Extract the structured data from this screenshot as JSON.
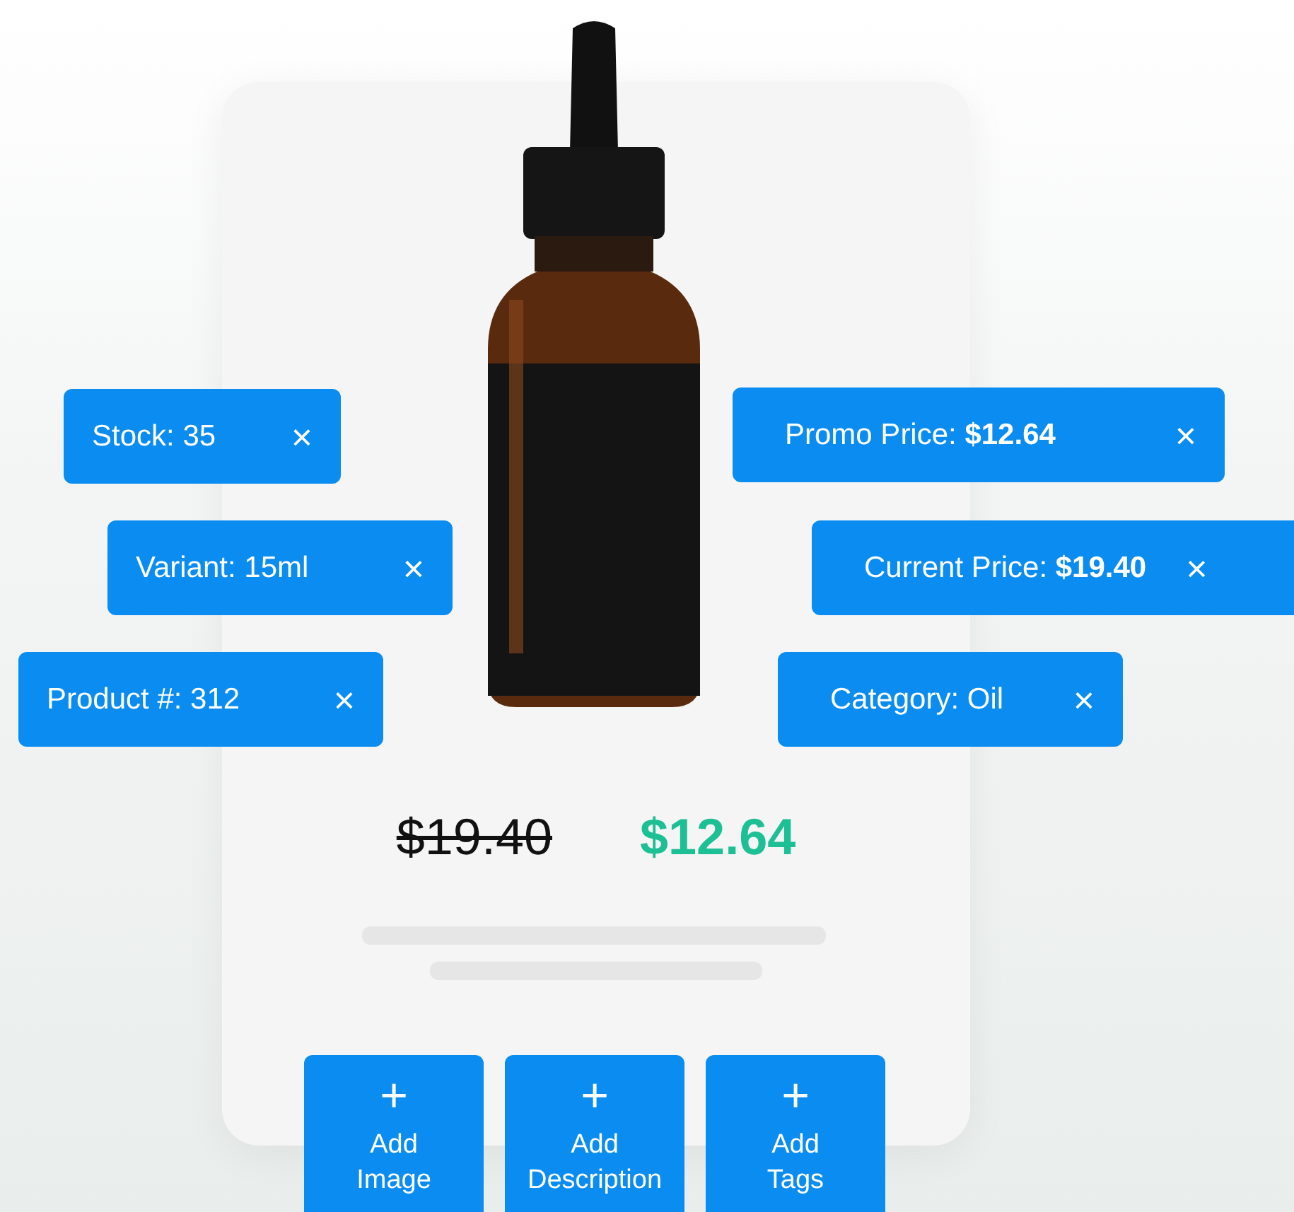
{
  "tags": [
    {
      "label": "Stock: 35",
      "close": "×"
    },
    {
      "label": "Variant: 15ml",
      "close": "×"
    },
    {
      "label": "Product #: 312",
      "close": "×"
    },
    {
      "label": "Promo Price: **$12.64**",
      "close": "×"
    },
    {
      "label": "Current Price: **$19.40**",
      "close": "×"
    },
    {
      "label": "Category: Oil",
      "close": "×"
    }
  ],
  "prices": {
    "original": "$19.40",
    "promo": "$12.64"
  },
  "actions": [
    {
      "icon": "+",
      "label": "Add\nImage"
    },
    {
      "icon": "+",
      "label": "Add\nDescription"
    },
    {
      "icon": "+",
      "label": "Add\nTags"
    }
  ]
}
